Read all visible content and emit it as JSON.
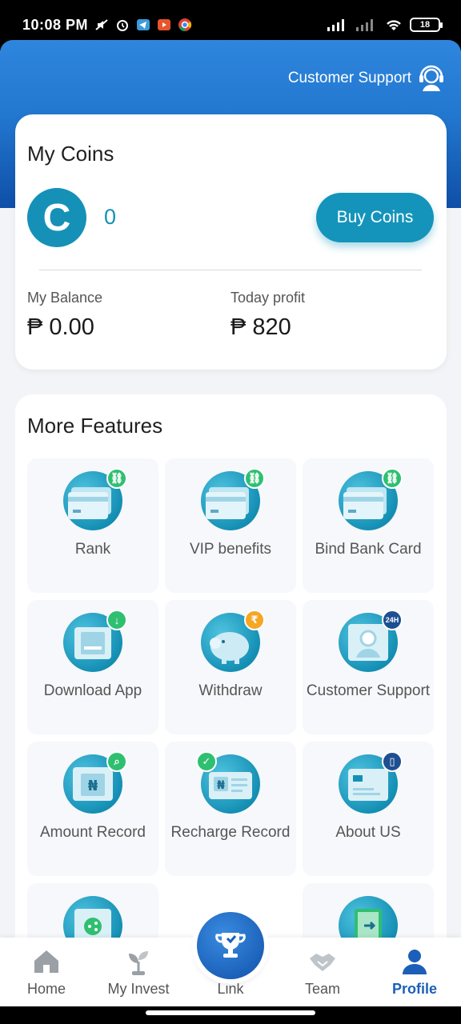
{
  "status_bar": {
    "time": "10:08 PM",
    "battery": "18"
  },
  "header": {
    "customer_support": "Customer Support"
  },
  "coins": {
    "title": "My Coins",
    "coin_letter": "C",
    "coin_count": "0",
    "buy_button": "Buy Coins",
    "balance_label": "My Balance",
    "balance_value": "₱ 0.00",
    "profit_label": "Today profit",
    "profit_value": "₱ 820"
  },
  "features": {
    "title": "More Features",
    "tiles": [
      {
        "label": "Rank",
        "icon": "card-link-icon",
        "badge": "link"
      },
      {
        "label": "VIP benefits",
        "icon": "card-link-icon",
        "badge": "link"
      },
      {
        "label": "Bind Bank Card",
        "icon": "card-link-icon",
        "badge": "link"
      },
      {
        "label": "Download App",
        "icon": "download-app-icon",
        "badge": "download"
      },
      {
        "label": "Withdraw",
        "icon": "piggy-bank-icon",
        "badge": "₹"
      },
      {
        "label": "Customer Support",
        "icon": "support-agent-icon",
        "badge": "24H"
      },
      {
        "label": "Amount Record",
        "icon": "naira-record-icon",
        "badge": "search"
      },
      {
        "label": "Recharge Record",
        "icon": "naira-document-icon",
        "badge": "check"
      },
      {
        "label": "About US",
        "icon": "about-document-icon",
        "badge": "building"
      }
    ]
  },
  "nav": {
    "items": [
      {
        "label": "Home",
        "icon": "home-icon"
      },
      {
        "label": "My Invest",
        "icon": "sprout-icon"
      },
      {
        "label": "Link",
        "icon": "trophy-icon"
      },
      {
        "label": "Team",
        "icon": "handshake-icon"
      },
      {
        "label": "Profile",
        "icon": "profile-icon"
      }
    ],
    "active": "Profile"
  },
  "colors": {
    "brand_blue": "#2277cf",
    "teal": "#1494bb",
    "active_nav": "#1b5fb8"
  }
}
